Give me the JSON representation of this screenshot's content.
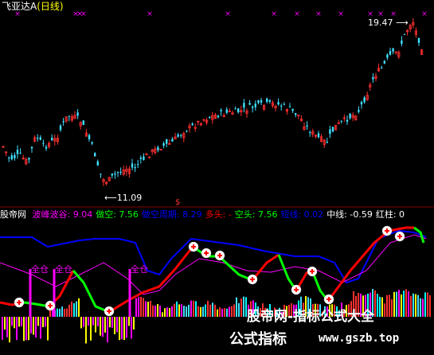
{
  "header": {
    "stock": "飞亚达A",
    "period": "(日线)"
  },
  "price_chart": {
    "high_label": "19.47",
    "low_label": "11.09",
    "signal_mark": "$"
  },
  "indicator_bar": {
    "name": "股帝网",
    "items": [
      {
        "label": "波峰波谷:",
        "value": "9.04",
        "color": "#ff00ff"
      },
      {
        "label": "做空:",
        "value": "7.56",
        "color": "#00ff00"
      },
      {
        "label": "做空周期:",
        "value": "8.29",
        "color": "#0000ff"
      },
      {
        "label": "多头:",
        "value": "-",
        "color": "#ff0000"
      },
      {
        "label": "空头:",
        "value": "7.56",
        "color": "#00ff00"
      },
      {
        "label": "短线:",
        "value": "0.02",
        "color": "#0000ff"
      },
      {
        "label": "中线:",
        "value": "-0.59",
        "color": "#ffffff"
      },
      {
        "label": "红柱:",
        "value": "0",
        "color": "#ffffff"
      }
    ]
  },
  "signals": {
    "full_position_label": "全仓"
  },
  "watermark": {
    "line1": "股帝网-指标公式大全",
    "line2": "公式指标",
    "url": "www.gszb.top"
  },
  "colors": {
    "up": "#ff3030",
    "down": "#40e0ff",
    "bull": "#ff0000",
    "bear": "#00ff00",
    "period": "#0000ff",
    "ma": "#ff00ff"
  }
}
